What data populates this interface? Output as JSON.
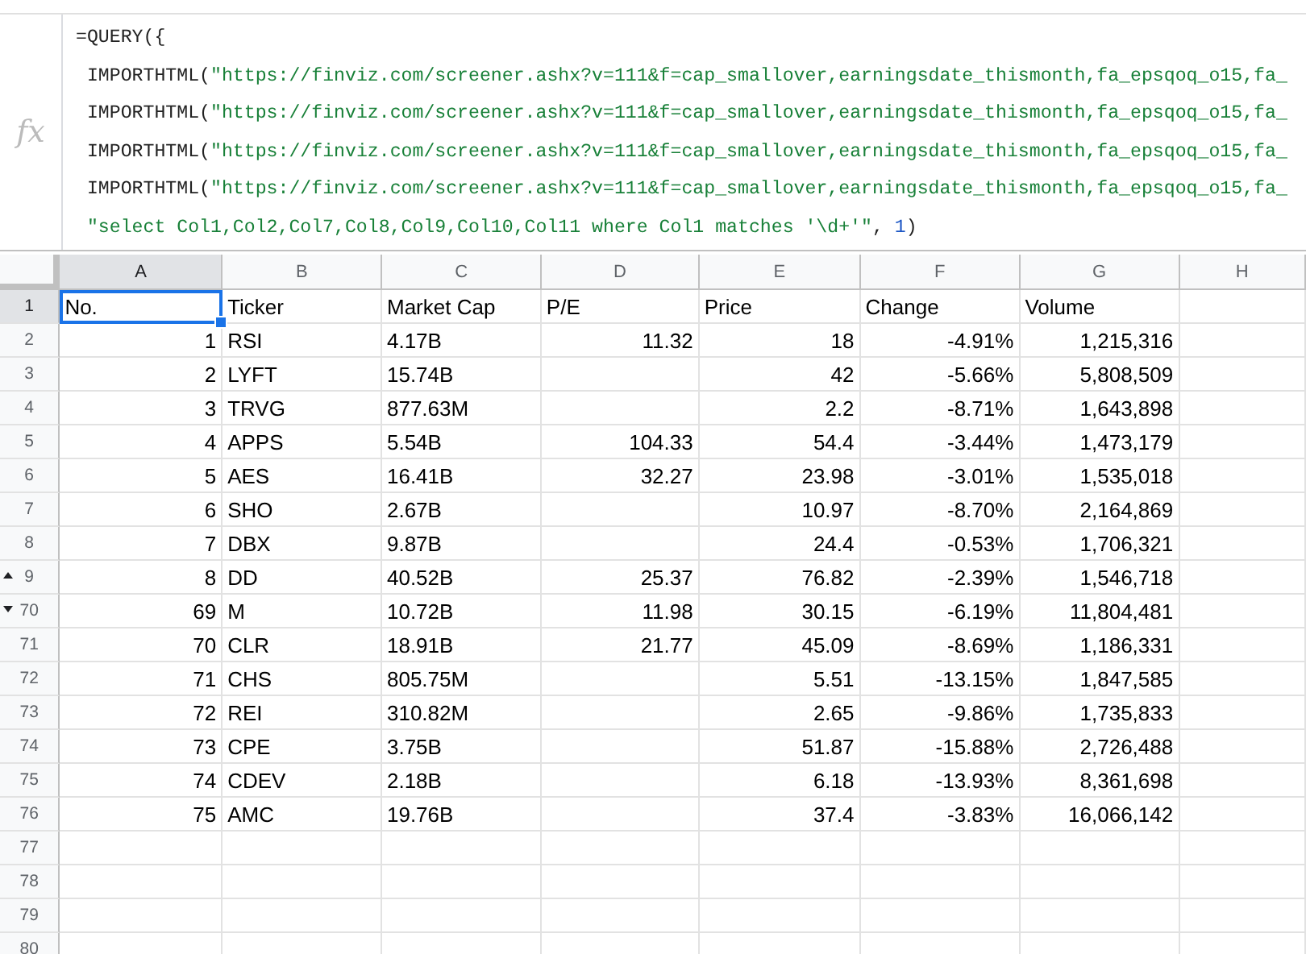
{
  "formula_bar": {
    "label": "fx",
    "lines": [
      [
        {
          "kind": "plain",
          "text": "=QUERY({"
        }
      ],
      [
        {
          "kind": "plain",
          "text": " IMPORTHTML("
        },
        {
          "kind": "string",
          "text": "\"https://finviz.com/screener.ashx?v=111&f=cap_smallover,earningsdate_thismonth,fa_epsqoq_o15,fa_"
        }
      ],
      [
        {
          "kind": "plain",
          "text": " IMPORTHTML("
        },
        {
          "kind": "string",
          "text": "\"https://finviz.com/screener.ashx?v=111&f=cap_smallover,earningsdate_thismonth,fa_epsqoq_o15,fa_"
        }
      ],
      [
        {
          "kind": "plain",
          "text": " IMPORTHTML("
        },
        {
          "kind": "string",
          "text": "\"https://finviz.com/screener.ashx?v=111&f=cap_smallover,earningsdate_thismonth,fa_epsqoq_o15,fa_"
        }
      ],
      [
        {
          "kind": "plain",
          "text": " IMPORTHTML("
        },
        {
          "kind": "string",
          "text": "\"https://finviz.com/screener.ashx?v=111&f=cap_smallover,earningsdate_thismonth,fa_epsqoq_o15,fa_"
        }
      ],
      [
        {
          "kind": "string",
          "text": " \"select Col1,Col2,Col7,Col8,Col9,Col10,Col11 where Col1 matches '\\d+'\""
        },
        {
          "kind": "plain",
          "text": ", "
        },
        {
          "kind": "number",
          "text": "1"
        },
        {
          "kind": "plain",
          "text": ")"
        }
      ]
    ]
  },
  "columns": [
    {
      "label": "A",
      "selected": true
    },
    {
      "label": "B",
      "selected": false
    },
    {
      "label": "C",
      "selected": false
    },
    {
      "label": "D",
      "selected": false
    },
    {
      "label": "E",
      "selected": false
    },
    {
      "label": "F",
      "selected": false
    },
    {
      "label": "G",
      "selected": false
    },
    {
      "label": "H",
      "selected": false
    }
  ],
  "header_row": {
    "number": "1",
    "selected": true,
    "hidden_below": false,
    "hidden_above": false,
    "cells": [
      "No.",
      "Ticker",
      "Market Cap",
      "P/E",
      "Price",
      "Change",
      "Volume"
    ]
  },
  "rows": [
    {
      "number": "2",
      "selected": false,
      "hidden_below": false,
      "hidden_above": false,
      "cells": [
        "1",
        "RSI",
        "4.17B",
        "11.32",
        "18",
        "-4.91%",
        "1,215,316"
      ]
    },
    {
      "number": "3",
      "selected": false,
      "hidden_below": false,
      "hidden_above": false,
      "cells": [
        "2",
        "LYFT",
        "15.74B",
        null,
        "42",
        "-5.66%",
        "5,808,509"
      ]
    },
    {
      "number": "4",
      "selected": false,
      "hidden_below": false,
      "hidden_above": false,
      "cells": [
        "3",
        "TRVG",
        "877.63M",
        null,
        "2.2",
        "-8.71%",
        "1,643,898"
      ]
    },
    {
      "number": "5",
      "selected": false,
      "hidden_below": false,
      "hidden_above": false,
      "cells": [
        "4",
        "APPS",
        "5.54B",
        "104.33",
        "54.4",
        "-3.44%",
        "1,473,179"
      ]
    },
    {
      "number": "6",
      "selected": false,
      "hidden_below": false,
      "hidden_above": false,
      "cells": [
        "5",
        "AES",
        "16.41B",
        "32.27",
        "23.98",
        "-3.01%",
        "1,535,018"
      ]
    },
    {
      "number": "7",
      "selected": false,
      "hidden_below": false,
      "hidden_above": false,
      "cells": [
        "6",
        "SHO",
        "2.67B",
        null,
        "10.97",
        "-8.70%",
        "2,164,869"
      ]
    },
    {
      "number": "8",
      "selected": false,
      "hidden_below": false,
      "hidden_above": false,
      "cells": [
        "7",
        "DBX",
        "9.87B",
        null,
        "24.4",
        "-0.53%",
        "1,706,321"
      ]
    },
    {
      "number": "9",
      "selected": false,
      "hidden_below": true,
      "hidden_above": false,
      "cells": [
        "8",
        "DD",
        "40.52B",
        "25.37",
        "76.82",
        "-2.39%",
        "1,546,718"
      ]
    },
    {
      "number": "70",
      "selected": false,
      "hidden_below": false,
      "hidden_above": true,
      "cells": [
        "69",
        "M",
        "10.72B",
        "11.98",
        "30.15",
        "-6.19%",
        "11,804,481"
      ]
    },
    {
      "number": "71",
      "selected": false,
      "hidden_below": false,
      "hidden_above": false,
      "cells": [
        "70",
        "CLR",
        "18.91B",
        "21.77",
        "45.09",
        "-8.69%",
        "1,186,331"
      ]
    },
    {
      "number": "72",
      "selected": false,
      "hidden_below": false,
      "hidden_above": false,
      "cells": [
        "71",
        "CHS",
        "805.75M",
        null,
        "5.51",
        "-13.15%",
        "1,847,585"
      ]
    },
    {
      "number": "73",
      "selected": false,
      "hidden_below": false,
      "hidden_above": false,
      "cells": [
        "72",
        "REI",
        "310.82M",
        null,
        "2.65",
        "-9.86%",
        "1,735,833"
      ]
    },
    {
      "number": "74",
      "selected": false,
      "hidden_below": false,
      "hidden_above": false,
      "cells": [
        "73",
        "CPE",
        "3.75B",
        null,
        "51.87",
        "-15.88%",
        "2,726,488"
      ]
    },
    {
      "number": "75",
      "selected": false,
      "hidden_below": false,
      "hidden_above": false,
      "cells": [
        "74",
        "CDEV",
        "2.18B",
        null,
        "6.18",
        "-13.93%",
        "8,361,698"
      ]
    },
    {
      "number": "76",
      "selected": false,
      "hidden_below": false,
      "hidden_above": false,
      "cells": [
        "75",
        "AMC",
        "19.76B",
        null,
        "37.4",
        "-3.83%",
        "16,066,142"
      ]
    },
    {
      "number": "77",
      "selected": false,
      "hidden_below": false,
      "hidden_above": false
    },
    {
      "number": "78",
      "selected": false,
      "hidden_below": false,
      "hidden_above": false
    },
    {
      "number": "79",
      "selected": false,
      "hidden_below": false,
      "hidden_above": false
    },
    {
      "number": "80",
      "selected": false,
      "hidden_below": false,
      "hidden_above": false
    }
  ]
}
